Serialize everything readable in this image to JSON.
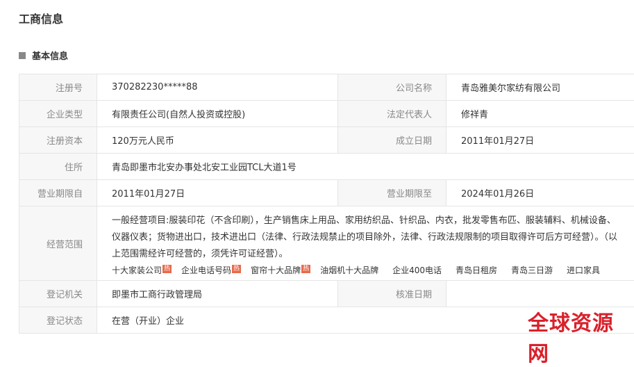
{
  "page_title": "工商信息",
  "section_title": "基本信息",
  "rows": {
    "reg_no": {
      "label": "注册号",
      "value": "370282230*****88"
    },
    "company_name": {
      "label": "公司名称",
      "value": "青岛雅美尔家纺有限公司"
    },
    "company_type": {
      "label": "企业类型",
      "value": "有限责任公司(自然人投资或控股)"
    },
    "legal_rep": {
      "label": "法定代表人",
      "value": "修祥青"
    },
    "capital": {
      "label": "注册资本",
      "value": "120万元人民币"
    },
    "founded": {
      "label": "成立日期",
      "value": "2011年01月27日"
    },
    "address": {
      "label": "住所",
      "value": "青岛即墨市北安办事处北安工业园TCL大道1号"
    },
    "term_from": {
      "label": "营业期限自",
      "value": "2011年01月27日"
    },
    "term_to": {
      "label": "营业期限至",
      "value": "2024年01月26日"
    },
    "scope": {
      "label": "经营范围",
      "value": "一般经营项目:服装印花（不含印刷），生产销售床上用品、家用纺织品、针织品、内衣，批发零售布匹、服装辅料、机械设备、仪器仪表；货物进出口，技术进出口（法律、行政法规禁止的项目除外，法律、行政法规限制的项目取得许可后方可经营）。（以上范围需经许可经营的，须凭许可证经营）。"
    },
    "authority": {
      "label": "登记机关",
      "value": "即墨市工商行政管理局"
    },
    "approval": {
      "label": "核准日期",
      "value": ""
    },
    "status": {
      "label": "登记状态",
      "value": "在营（开业）企业"
    }
  },
  "tags": [
    {
      "text": "十大家装公司",
      "hot": "热"
    },
    {
      "text": "企业电话号码",
      "hot": "热"
    },
    {
      "text": "窗帘十大品牌",
      "hot": "热"
    },
    {
      "text": "油烟机十大品牌",
      "hot": ""
    },
    {
      "text": "企业400电话",
      "hot": ""
    },
    {
      "text": "青岛日租房",
      "hot": ""
    },
    {
      "text": "青岛三日游",
      "hot": ""
    },
    {
      "text": "进口家具",
      "hot": ""
    }
  ],
  "watermark": "全球资源网"
}
